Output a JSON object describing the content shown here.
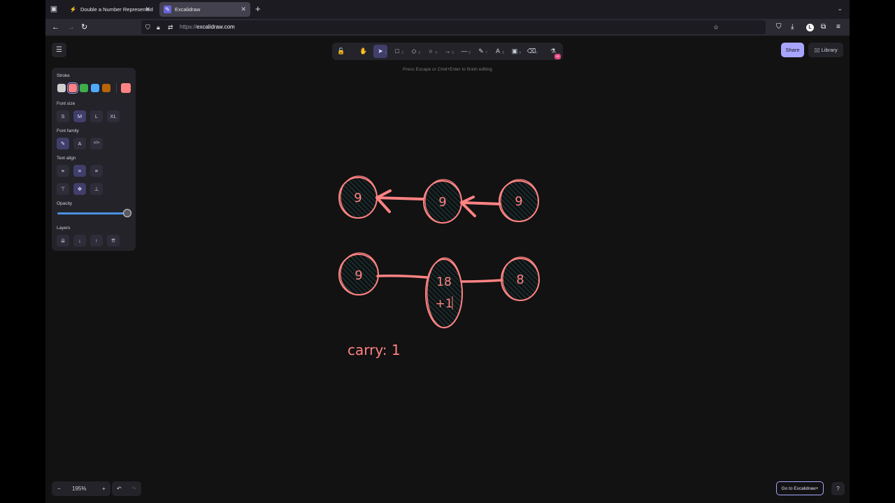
{
  "browser": {
    "tabs": [
      {
        "title": "Double a Number Represented as a Linked List",
        "active": false
      },
      {
        "title": "Excalidraw",
        "active": true
      }
    ],
    "url_protocol": "https://",
    "url_host": "excalidraw.com",
    "avatar_letter": "L"
  },
  "toolbar": {
    "tools": [
      {
        "icon": "lock-icon",
        "glyph": "🔓",
        "key": ""
      },
      {
        "icon": "hand-icon",
        "glyph": "✋",
        "key": ""
      },
      {
        "icon": "selection-icon",
        "glyph": "➤",
        "key": "1",
        "active": true
      },
      {
        "icon": "rectangle-icon",
        "glyph": "□",
        "key": "2"
      },
      {
        "icon": "diamond-icon",
        "glyph": "◇",
        "key": "3"
      },
      {
        "icon": "ellipse-icon",
        "glyph": "○",
        "key": "4"
      },
      {
        "icon": "arrow-icon",
        "glyph": "→",
        "key": "5"
      },
      {
        "icon": "line-icon",
        "glyph": "—",
        "key": "6"
      },
      {
        "icon": "pencil-icon",
        "glyph": "✎",
        "key": "7"
      },
      {
        "icon": "text-icon",
        "glyph": "A",
        "key": "8"
      },
      {
        "icon": "image-icon",
        "glyph": "▣",
        "key": "9"
      },
      {
        "icon": "eraser-icon",
        "glyph": "⌫",
        "key": "0"
      },
      {
        "icon": "extra-tools-icon",
        "glyph": "⚗",
        "key": ""
      }
    ],
    "ai_badge": "AI",
    "hint": "Press Escape or Cmd+Enter to finish editing",
    "share_label": "Share",
    "library_label": "Library"
  },
  "panel": {
    "stroke_label": "Stroke",
    "stroke_colors": [
      "#d0d0d0",
      "#ff8383",
      "#3dae49",
      "#4dabf7",
      "#b8650a"
    ],
    "selected_stroke": "#ff8383",
    "font_size_label": "Font size",
    "font_sizes": [
      "S",
      "M",
      "L",
      "XL"
    ],
    "font_family_label": "Font family",
    "font_families": [
      {
        "icon": "hand-drawn-font-icon",
        "glyph": "✎"
      },
      {
        "icon": "normal-font-icon",
        "glyph": "A"
      },
      {
        "icon": "code-font-icon",
        "glyph": "</>"
      }
    ],
    "text_align_label": "Text align",
    "align_h": [
      {
        "icon": "align-left-icon",
        "glyph": "≡"
      },
      {
        "icon": "align-center-icon",
        "glyph": "≡"
      },
      {
        "icon": "align-right-icon",
        "glyph": "≡"
      }
    ],
    "align_v": [
      {
        "icon": "align-top-icon",
        "glyph": "⊤"
      },
      {
        "icon": "align-middle-icon",
        "glyph": "✥"
      },
      {
        "icon": "align-bottom-icon",
        "glyph": "⊥"
      }
    ],
    "opacity_label": "Opacity",
    "opacity_value": 100,
    "layers_label": "Layers",
    "layers": [
      {
        "icon": "send-to-back-icon",
        "glyph": "⇊"
      },
      {
        "icon": "send-backward-icon",
        "glyph": "↓"
      },
      {
        "icon": "bring-forward-icon",
        "glyph": "↑"
      },
      {
        "icon": "bring-to-front-icon",
        "glyph": "⇈"
      }
    ]
  },
  "canvas": {
    "row1": [
      "9",
      "9",
      "9"
    ],
    "row2": [
      "9",
      "18",
      "+1",
      "8"
    ],
    "carry_text": "carry: 1"
  },
  "footer": {
    "zoom_out": "−",
    "zoom": "195%",
    "zoom_in": "+",
    "undo": "↶",
    "redo": "↷",
    "goto_label": "Go to Excalidraw+",
    "help": "?"
  },
  "colors": {
    "accent": "#a8a5ff",
    "stroke": "#ff8383",
    "background": "#121212"
  }
}
